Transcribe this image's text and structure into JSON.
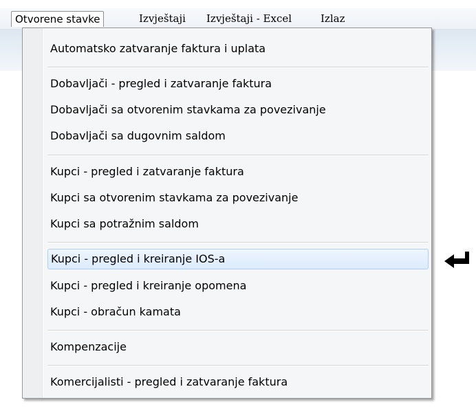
{
  "menubar": {
    "items": [
      {
        "label": "Otvorene stavke"
      },
      {
        "label": "Izvještaji"
      },
      {
        "label": "Izvještaji - Excel"
      },
      {
        "label": "Izlaz"
      }
    ]
  },
  "dropdown": {
    "items": [
      {
        "label": "Automatsko zatvaranje faktura i uplata"
      },
      {
        "label": "Dobavljači - pregled i zatvaranje faktura"
      },
      {
        "label": "Dobavljači sa otvorenim stavkama za povezivanje"
      },
      {
        "label": "Dobavljači sa dugovnim saldom"
      },
      {
        "label": "Kupci - pregled i zatvaranje faktura"
      },
      {
        "label": "Kupci sa otvorenim stavkama za povezivanje"
      },
      {
        "label": "Kupci sa potražnim saldom"
      },
      {
        "label": "Kupci - pregled i kreiranje IOS-a"
      },
      {
        "label": "Kupci - pregled i kreiranje opomena"
      },
      {
        "label": "Kupci - obračun kamata"
      },
      {
        "label": "Kompenzacije"
      },
      {
        "label": "Komercijalisti - pregled i zatvaranje faktura"
      }
    ],
    "highlighted_index": 7
  },
  "annotation": {
    "icon": "left-arrow-icon",
    "color": "#000000"
  }
}
